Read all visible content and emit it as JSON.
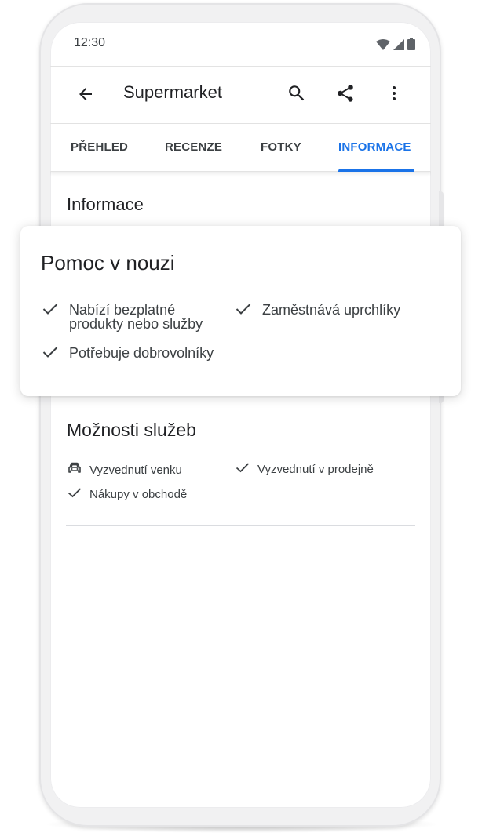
{
  "status_bar": {
    "time": "12:30"
  },
  "app_bar": {
    "title": "Supermarket",
    "back_icon": "arrow-back-icon",
    "actions": [
      "search-icon",
      "share-icon",
      "more-vert-icon"
    ]
  },
  "tabs": [
    {
      "label": "PŘEHLED",
      "active": false
    },
    {
      "label": "RECENZE",
      "active": false
    },
    {
      "label": "FOTKY",
      "active": false
    },
    {
      "label": "INFORMACE",
      "active": true
    }
  ],
  "info": {
    "title": "Informace"
  },
  "help_card": {
    "title": "Pomoc v nouzi",
    "items": [
      {
        "label": "Nabízí bezplatné\nprodukty nebo služby",
        "icon": "check-icon"
      },
      {
        "label": "Zaměstnává uprchlíky",
        "icon": "check-icon"
      },
      {
        "label": "Potřebuje dobrovolníky",
        "icon": "check-icon"
      }
    ]
  },
  "service_options": {
    "title": "Možnosti služeb",
    "items": [
      {
        "label": "Vyzvednutí venku",
        "icon": "car-icon"
      },
      {
        "label": "Vyzvednutí v prodejně",
        "icon": "check-icon"
      },
      {
        "label": "Nákupy v obchodě",
        "icon": "check-icon"
      }
    ]
  },
  "colors": {
    "accent": "#1a73e8",
    "text_primary": "#202124",
    "text_secondary": "#3c4043",
    "divider": "#dadce0"
  }
}
